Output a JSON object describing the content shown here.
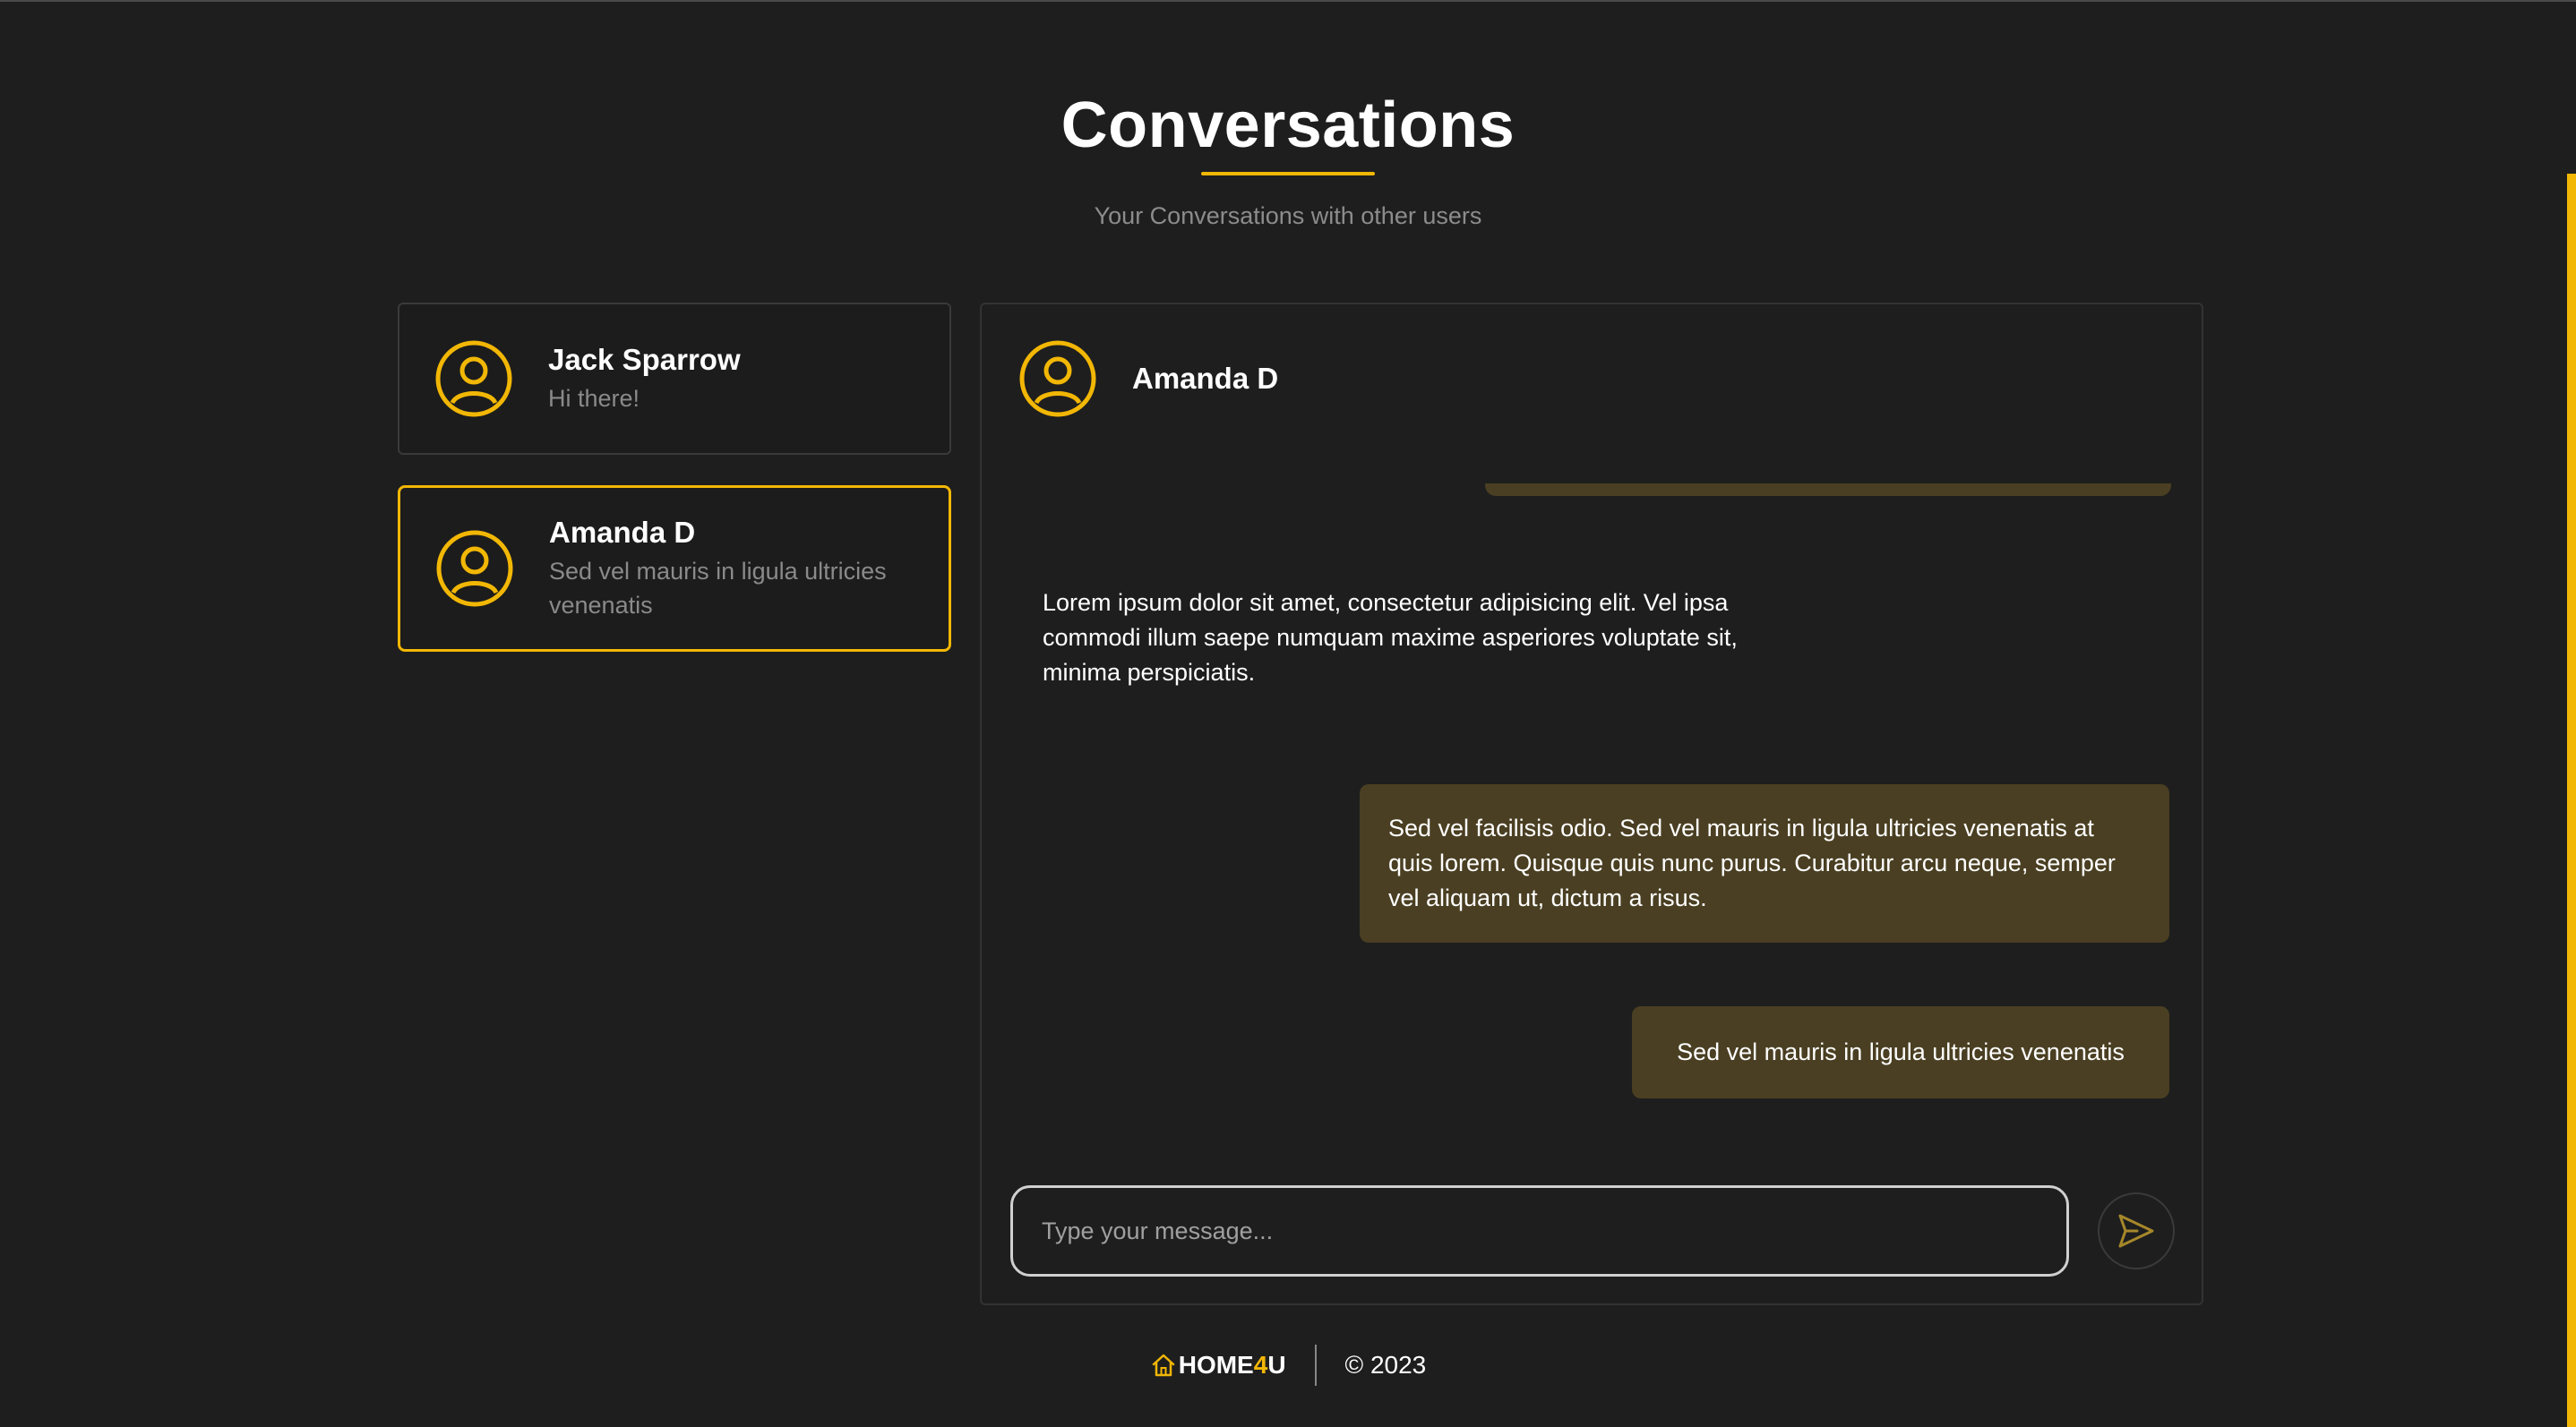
{
  "header": {
    "title": "Conversations",
    "subtitle": "Your Conversations with other users"
  },
  "conversations": [
    {
      "name": "Jack Sparrow",
      "preview": "Hi there!",
      "active": false
    },
    {
      "name": "Amanda D",
      "preview": "Sed vel mauris in ligula ultricies venenatis",
      "active": true
    }
  ],
  "chat": {
    "contact_name": "Amanda D",
    "messages": [
      {
        "direction": "received",
        "text": "Lorem ipsum dolor sit amet, consectetur adipisicing elit. Vel ipsa commodi illum saepe numquam maxime asperiores voluptate sit, minima perspiciatis."
      },
      {
        "direction": "sent",
        "text": "Sed vel facilisis odio. Sed vel mauris in ligula ultricies venenatis at quis lorem. Quisque quis nunc purus. Curabitur arcu neque, semper vel aliquam ut, dictum a risus."
      },
      {
        "direction": "sent",
        "text": "Sed vel mauris in ligula ultricies venenatis"
      }
    ],
    "input_placeholder": "Type your message...",
    "send_icon": "send-icon"
  },
  "footer": {
    "logo_prefix": "HOME",
    "logo_accent": "4",
    "logo_suffix": "U",
    "copyright": "© 2023"
  },
  "colors": {
    "background": "#1e1e1e",
    "accent": "#f2b705",
    "sent_bubble": "#4a3f22",
    "muted_text": "#8a8a8a"
  }
}
